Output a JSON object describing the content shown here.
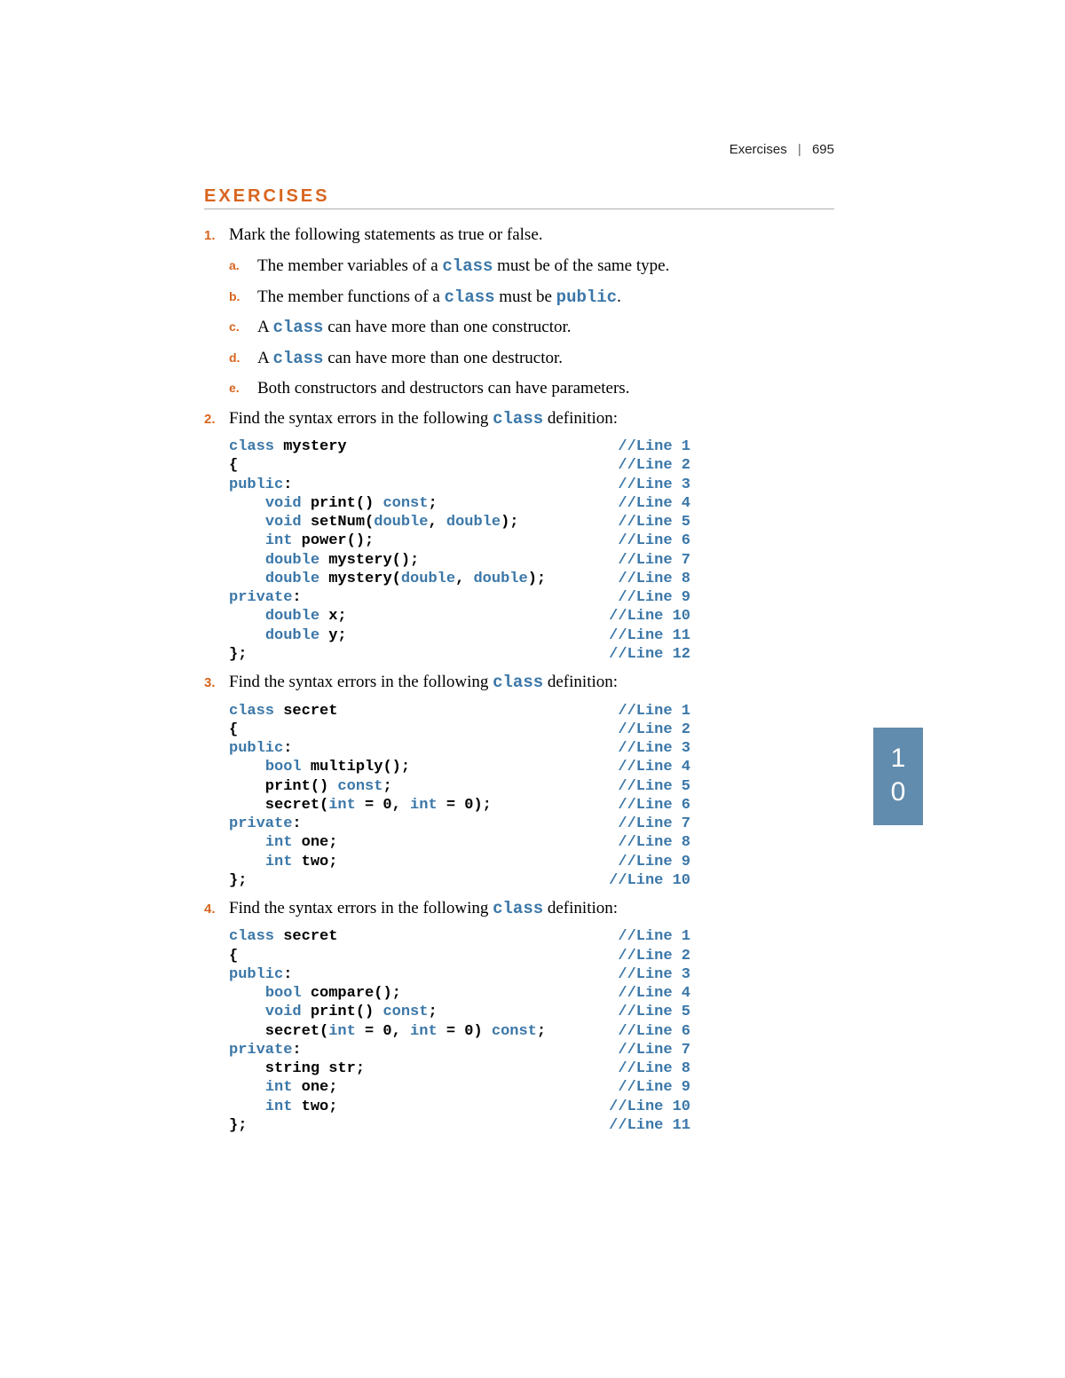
{
  "header": {
    "section": "Exercises",
    "page": "695"
  },
  "title": "EXERCISES",
  "sidetab": {
    "top": "1",
    "bottom": "0"
  },
  "questions": [
    {
      "num": "1.",
      "text_parts": [
        "Mark the following statements as true or false."
      ],
      "sub": [
        {
          "letter": "a.",
          "parts": [
            [
              "t",
              "The member variables of a "
            ],
            [
              "kw",
              "class"
            ],
            [
              "t",
              " must be of the same type."
            ]
          ]
        },
        {
          "letter": "b.",
          "parts": [
            [
              "t",
              "The member functions of a "
            ],
            [
              "kw",
              "class"
            ],
            [
              "t",
              " must be "
            ],
            [
              "kw",
              "public"
            ],
            [
              "t",
              "."
            ]
          ]
        },
        {
          "letter": "c.",
          "parts": [
            [
              "t",
              "A "
            ],
            [
              "kw",
              "class"
            ],
            [
              "t",
              " can have more than one constructor."
            ]
          ]
        },
        {
          "letter": "d.",
          "parts": [
            [
              "t",
              "A "
            ],
            [
              "kw",
              "class"
            ],
            [
              "t",
              " can have more than one destructor."
            ]
          ]
        },
        {
          "letter": "e.",
          "parts": [
            [
              "t",
              "Both constructors and destructors can have parameters."
            ]
          ]
        }
      ]
    },
    {
      "num": "2.",
      "text_parts": [
        [
          "t",
          "Find the syntax errors in the following "
        ],
        [
          "kw",
          "class"
        ],
        [
          "t",
          " definition:"
        ]
      ],
      "code": [
        {
          "left": [
            [
              "kw",
              "class"
            ],
            [
              "p",
              " mystery"
            ]
          ],
          "cm": "//Line 1"
        },
        {
          "left": [
            [
              "p",
              "{"
            ]
          ],
          "cm": "//Line 2"
        },
        {
          "left": [
            [
              "kw",
              "public"
            ],
            [
              "p",
              ":"
            ]
          ],
          "cm": "//Line 3"
        },
        {
          "left": [
            [
              "p",
              "    "
            ],
            [
              "kw",
              "void"
            ],
            [
              "p",
              " print() "
            ],
            [
              "kw",
              "const"
            ],
            [
              "p",
              ";"
            ]
          ],
          "cm": "//Line 4"
        },
        {
          "left": [
            [
              "p",
              "    "
            ],
            [
              "kw",
              "void"
            ],
            [
              "p",
              " setNum("
            ],
            [
              "kw",
              "double"
            ],
            [
              "p",
              ", "
            ],
            [
              "kw",
              "double"
            ],
            [
              "p",
              ");"
            ]
          ],
          "cm": "//Line 5"
        },
        {
          "left": [
            [
              "p",
              "    "
            ],
            [
              "kw",
              "int"
            ],
            [
              "p",
              " power();"
            ]
          ],
          "cm": "//Line 6"
        },
        {
          "left": [
            [
              "p",
              "    "
            ],
            [
              "kw",
              "double"
            ],
            [
              "p",
              " mystery();"
            ]
          ],
          "cm": "//Line 7"
        },
        {
          "left": [
            [
              "p",
              "    "
            ],
            [
              "kw",
              "double"
            ],
            [
              "p",
              " mystery("
            ],
            [
              "kw",
              "double"
            ],
            [
              "p",
              ", "
            ],
            [
              "kw",
              "double"
            ],
            [
              "p",
              ");"
            ]
          ],
          "cm": "//Line 8"
        },
        {
          "left": [
            [
              "kw",
              "private"
            ],
            [
              "p",
              ":"
            ]
          ],
          "cm": "//Line 9"
        },
        {
          "left": [
            [
              "p",
              "    "
            ],
            [
              "kw",
              "double"
            ],
            [
              "p",
              " x;"
            ]
          ],
          "cm": "//Line 10"
        },
        {
          "left": [
            [
              "p",
              "    "
            ],
            [
              "kw",
              "double"
            ],
            [
              "p",
              " y;"
            ]
          ],
          "cm": "//Line 11"
        },
        {
          "left": [
            [
              "p",
              "};"
            ]
          ],
          "cm": "//Line 12"
        }
      ]
    },
    {
      "num": "3.",
      "text_parts": [
        [
          "t",
          "Find the syntax errors in the following "
        ],
        [
          "kw",
          "class"
        ],
        [
          "t",
          " definition:"
        ]
      ],
      "code": [
        {
          "left": [
            [
              "kw",
              "class"
            ],
            [
              "p",
              " secret"
            ]
          ],
          "cm": "//Line 1"
        },
        {
          "left": [
            [
              "p",
              "{"
            ]
          ],
          "cm": "//Line 2"
        },
        {
          "left": [
            [
              "kw",
              "public"
            ],
            [
              "p",
              ":"
            ]
          ],
          "cm": "//Line 3"
        },
        {
          "left": [
            [
              "p",
              "    "
            ],
            [
              "kw",
              "bool"
            ],
            [
              "p",
              " multiply();"
            ]
          ],
          "cm": "//Line 4"
        },
        {
          "left": [
            [
              "p",
              "    print() "
            ],
            [
              "kw",
              "const"
            ],
            [
              "p",
              ";"
            ]
          ],
          "cm": "//Line 5"
        },
        {
          "left": [
            [
              "p",
              "    secret("
            ],
            [
              "kw",
              "int"
            ],
            [
              "p",
              " = 0, "
            ],
            [
              "kw",
              "int"
            ],
            [
              "p",
              " = 0);"
            ]
          ],
          "cm": "//Line 6"
        },
        {
          "left": [
            [
              "kw",
              "private"
            ],
            [
              "p",
              ":"
            ]
          ],
          "cm": "//Line 7"
        },
        {
          "left": [
            [
              "p",
              "    "
            ],
            [
              "kw",
              "int"
            ],
            [
              "p",
              " one;"
            ]
          ],
          "cm": "//Line 8"
        },
        {
          "left": [
            [
              "p",
              "    "
            ],
            [
              "kw",
              "int"
            ],
            [
              "p",
              " two;"
            ]
          ],
          "cm": "//Line 9"
        },
        {
          "left": [
            [
              "p",
              "};"
            ]
          ],
          "cm": "//Line 10"
        }
      ]
    },
    {
      "num": "4.",
      "text_parts": [
        [
          "t",
          "Find the syntax errors in the following "
        ],
        [
          "kw",
          "class"
        ],
        [
          "t",
          " definition:"
        ]
      ],
      "code": [
        {
          "left": [
            [
              "kw",
              "class"
            ],
            [
              "p",
              " secret"
            ]
          ],
          "cm": "//Line 1"
        },
        {
          "left": [
            [
              "p",
              "{"
            ]
          ],
          "cm": "//Line 2"
        },
        {
          "left": [
            [
              "kw",
              "public"
            ],
            [
              "p",
              ":"
            ]
          ],
          "cm": "//Line 3"
        },
        {
          "left": [
            [
              "p",
              "    "
            ],
            [
              "kw",
              "bool"
            ],
            [
              "p",
              " compare();"
            ]
          ],
          "cm": "//Line 4"
        },
        {
          "left": [
            [
              "p",
              "    "
            ],
            [
              "kw",
              "void"
            ],
            [
              "p",
              " print() "
            ],
            [
              "kw",
              "const"
            ],
            [
              "p",
              ";"
            ]
          ],
          "cm": "//Line 5"
        },
        {
          "left": [
            [
              "p",
              "    secret("
            ],
            [
              "kw",
              "int"
            ],
            [
              "p",
              " = 0, "
            ],
            [
              "kw",
              "int"
            ],
            [
              "p",
              " = 0) "
            ],
            [
              "kw",
              "const"
            ],
            [
              "p",
              ";"
            ]
          ],
          "cm": "//Line 6"
        },
        {
          "left": [
            [
              "kw",
              "private"
            ],
            [
              "p",
              ":"
            ]
          ],
          "cm": "//Line 7"
        },
        {
          "left": [
            [
              "p",
              "    string str;"
            ]
          ],
          "cm": "//Line 8"
        },
        {
          "left": [
            [
              "p",
              "    "
            ],
            [
              "kw",
              "int"
            ],
            [
              "p",
              " one;"
            ]
          ],
          "cm": "//Line 9"
        },
        {
          "left": [
            [
              "p",
              "    "
            ],
            [
              "kw",
              "int"
            ],
            [
              "p",
              " two;"
            ]
          ],
          "cm": "//Line 10"
        },
        {
          "left": [
            [
              "p",
              "};"
            ]
          ],
          "cm": "//Line 11"
        }
      ]
    }
  ]
}
